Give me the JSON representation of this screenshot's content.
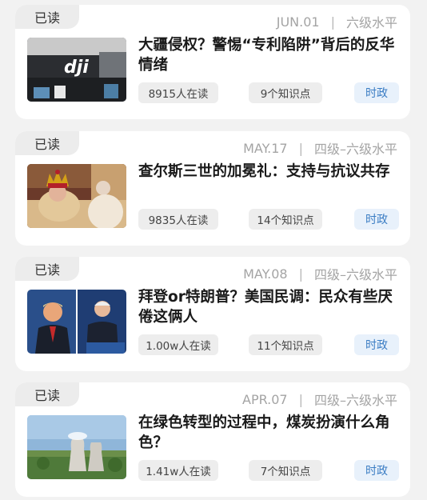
{
  "articles": [
    {
      "badge": "已读",
      "date": "JUN.01",
      "separator": "|",
      "level": "六级水平",
      "title": "大疆侵权？警惕“专利陷阱”背后的反华情绪",
      "readers": "8915人在读",
      "points": "9个知识点",
      "category": "时政",
      "image": "dji-store-sign"
    },
    {
      "badge": "已读",
      "date": "MAY.17",
      "separator": "|",
      "level": "四级–六级水平",
      "title": "查尔斯三世的加冕礼：支持与抗议共存",
      "readers": "9835人在读",
      "points": "14个知识点",
      "category": "时政",
      "image": "coronation-crown"
    },
    {
      "badge": "已读",
      "date": "MAY.08",
      "separator": "|",
      "level": "四级–六级水平",
      "title": "拜登or特朗普？美国民调：民众有些厌倦这俩人",
      "readers": "1.00w人在读",
      "points": "11个知识点",
      "category": "时政",
      "image": "debate-split"
    },
    {
      "badge": "已读",
      "date": "APR.07",
      "separator": "|",
      "level": "四级–六级水平",
      "title": "在绿色转型的过程中，煤炭扮演什么角色？",
      "readers": "1.41w人在读",
      "points": "7个知识点",
      "category": "时政",
      "image": "cooling-towers"
    }
  ]
}
